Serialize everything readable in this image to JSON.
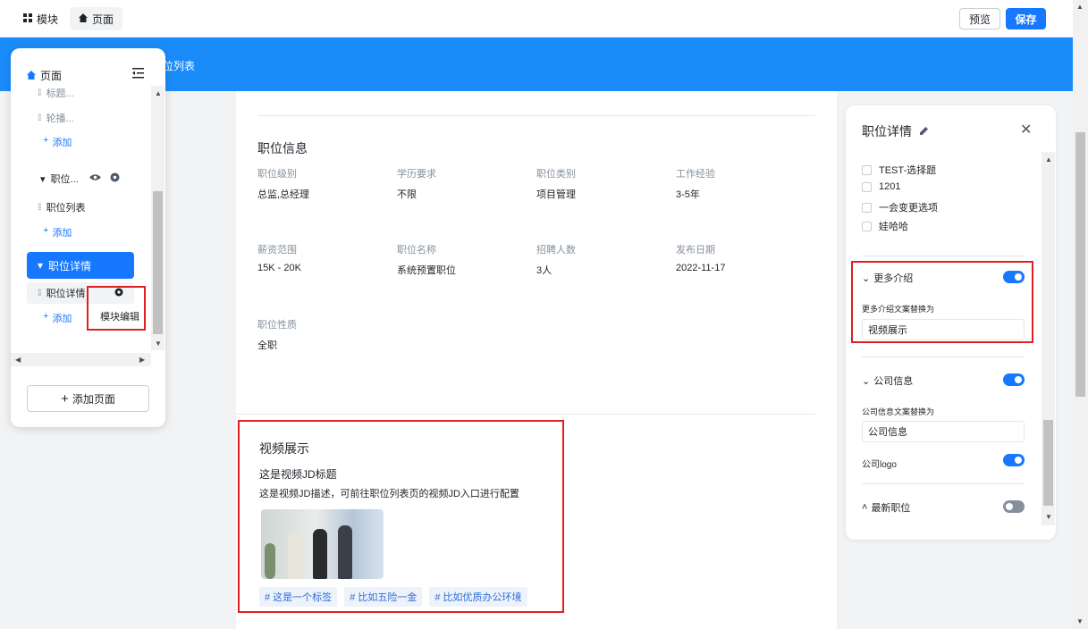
{
  "topbar": {
    "modules_label": "模块",
    "page_label": "页面",
    "preview_label": "预览",
    "save_label": "保存"
  },
  "banner": {
    "text": "位列表"
  },
  "left_panel": {
    "root_label": "页面",
    "items": [
      {
        "label": "标题..."
      },
      {
        "label": "轮播..."
      },
      {
        "label": "职位..."
      },
      {
        "label": "职位列表"
      },
      {
        "label": "职位详情"
      },
      {
        "label": "职位详情"
      }
    ],
    "add_label": "添加",
    "tooltip": "模块编辑",
    "add_page_label": "添加页面"
  },
  "canvas": {
    "section_title": "职位信息",
    "fields": [
      {
        "label": "职位级别",
        "value": "总监,总经理"
      },
      {
        "label": "学历要求",
        "value": "不限"
      },
      {
        "label": "职位类别",
        "value": "项目管理"
      },
      {
        "label": "工作经验",
        "value": "3-5年"
      },
      {
        "label": "薪资范围",
        "value": "15K - 20K"
      },
      {
        "label": "职位名称",
        "value": "系统预置职位"
      },
      {
        "label": "招聘人数",
        "value": "3人"
      },
      {
        "label": "发布日期",
        "value": "2022-11-17"
      },
      {
        "label": "职位性质",
        "value": "全职"
      }
    ],
    "video": {
      "title": "视频展示",
      "subtitle": "这是视频JD标题",
      "description": "这是视频JD描述，可前往职位列表页的视频JD入口进行配置",
      "tags": [
        "# 这是一个标签",
        "# 比如五险一金",
        "# 比如优质办公环境"
      ]
    }
  },
  "right_panel": {
    "title": "职位详情",
    "checkboxes": [
      "TEST-选择题",
      "1201",
      "一会变更选项",
      "娃哈哈"
    ],
    "more_intro": {
      "header": "更多介绍",
      "replace_label": "更多介绍文案替换为",
      "value": "视频展示",
      "enabled": true
    },
    "company": {
      "header": "公司信息",
      "replace_label": "公司信息文案替换为",
      "value": "公司信息",
      "logo_label": "公司logo",
      "enabled": true,
      "logo_enabled": true
    },
    "latest": {
      "header": "最新职位",
      "enabled": false
    }
  },
  "colors": {
    "accent": "#1677ff",
    "banner": "#1a8cfa",
    "highlight": "#e02020"
  }
}
